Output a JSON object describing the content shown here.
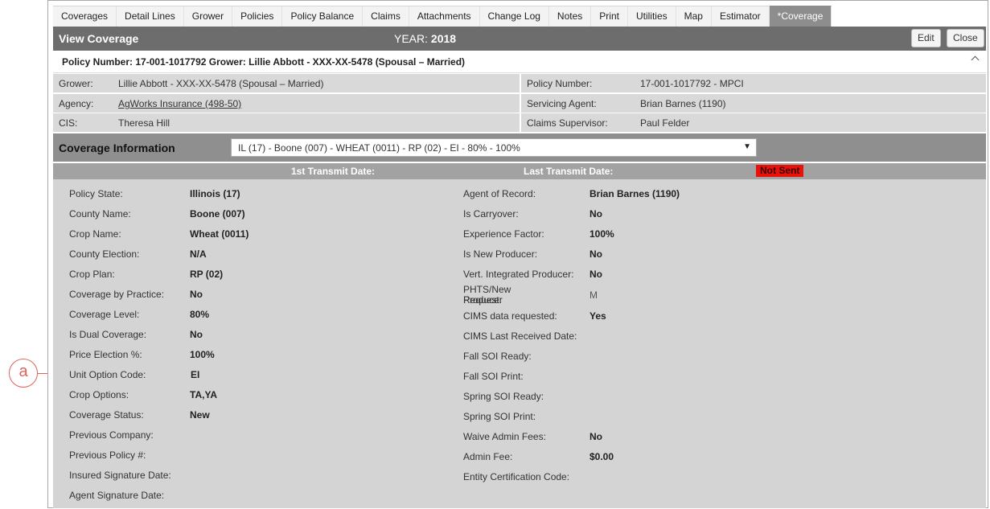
{
  "callout": {
    "label": "a"
  },
  "tabs": [
    {
      "label": "Coverages"
    },
    {
      "label": "Detail Lines"
    },
    {
      "label": "Grower"
    },
    {
      "label": "Policies"
    },
    {
      "label": "Policy Balance"
    },
    {
      "label": "Claims"
    },
    {
      "label": "Attachments"
    },
    {
      "label": "Change Log"
    },
    {
      "label": "Notes"
    },
    {
      "label": "Print"
    },
    {
      "label": "Utilities"
    },
    {
      "label": "Map"
    },
    {
      "label": "Estimator"
    },
    {
      "label": "*Coverage",
      "active": true
    }
  ],
  "header": {
    "title": "View Coverage",
    "year_label": "YEAR:",
    "year_value": "2018",
    "edit_label": "Edit",
    "close_label": "Close"
  },
  "policy_strip": {
    "text": "Policy Number: 17-001-1017792 Grower: Lillie Abbott - XXX-XX-5478 (Spousal – Married)"
  },
  "info": {
    "grower_label": "Grower:",
    "grower_value": "Lillie Abbott - XXX-XX-5478 (Spousal – Married)",
    "policy_number_label": "Policy Number:",
    "policy_number_value": "17-001-1017792 - MPCI",
    "agency_label": "Agency:",
    "agency_value": "AgWorks Insurance (498-50)",
    "servicing_agent_label": "Servicing Agent:",
    "servicing_agent_value": "Brian Barnes (1190)",
    "cis_label": "CIS:",
    "cis_value": "Theresa Hill",
    "claims_supervisor_label": "Claims Supervisor:",
    "claims_supervisor_value": "Paul Felder"
  },
  "coverage_info": {
    "title": "Coverage Information",
    "selected": "IL (17) - Boone (007) - WHEAT (0011) - RP (02) - EI - 80% - 100%",
    "arrow": "▼"
  },
  "transmit": {
    "first_label": "1st Transmit Date:",
    "last_label": "Last Transmit Date:",
    "status": "Not Sent",
    "status_color": "#e8120a"
  },
  "left_fields": [
    {
      "label": "Policy State:",
      "value": "Illinois (17)"
    },
    {
      "label": "County Name:",
      "value": "Boone (007)"
    },
    {
      "label": "Crop Name:",
      "value": "Wheat (0011)"
    },
    {
      "label": "County Election:",
      "value": "N/A"
    },
    {
      "label": "Crop Plan:",
      "value": "RP (02)"
    },
    {
      "label": "Coverage by Practice:",
      "value": "No"
    },
    {
      "label": "Coverage Level:",
      "value": "80%"
    },
    {
      "label": "Is Dual Coverage:",
      "value": "No"
    },
    {
      "label": "Price Election %:",
      "value": "100%"
    },
    {
      "label": "Unit Option Code:",
      "value": "EI"
    },
    {
      "label": "Crop Options:",
      "value": "TA,YA"
    },
    {
      "label": "Coverage Status:",
      "value": "New"
    },
    {
      "label": "Previous Company:",
      "value": ""
    },
    {
      "label": "Previous Policy #:",
      "value": ""
    },
    {
      "label": "Insured Signature Date:",
      "value": ""
    },
    {
      "label": "Agent Signature Date:",
      "value": ""
    }
  ],
  "right_fields": {
    "agent_of_record": {
      "label": "Agent of Record:",
      "value": "Brian Barnes (1190)"
    },
    "is_carryover": {
      "label": "Is Carryover:",
      "value": "No"
    },
    "experience_factor": {
      "label": "Experience Factor:",
      "value": "100%"
    },
    "is_new_producer": {
      "label": "Is New Producer:",
      "value": "No"
    },
    "vert_integrated": {
      "label": "Vert. Integrated Producer:",
      "value": "No"
    },
    "phts_label_1": "PHTS/New Producer",
    "phts_label_2": "Request:",
    "phts_value": "M",
    "cims_requested": {
      "label": "CIMS data requested:",
      "value": "Yes"
    },
    "cims_last_received": {
      "label": "CIMS Last Received Date:",
      "value": ""
    },
    "fall_soi_ready": {
      "label": "Fall SOI Ready:",
      "value": ""
    },
    "fall_soi_print": {
      "label": "Fall SOI Print:",
      "value": ""
    },
    "spring_soi_ready": {
      "label": "Spring SOI Ready:",
      "value": ""
    },
    "spring_soi_print": {
      "label": "Spring SOI Print:",
      "value": ""
    },
    "waive_admin_fees": {
      "label": "Waive Admin Fees:",
      "value": "No"
    },
    "admin_fee": {
      "label": "Admin Fee:",
      "value": "$0.00"
    },
    "entity_cert_code": {
      "label": "Entity Certification Code:",
      "value": ""
    }
  }
}
